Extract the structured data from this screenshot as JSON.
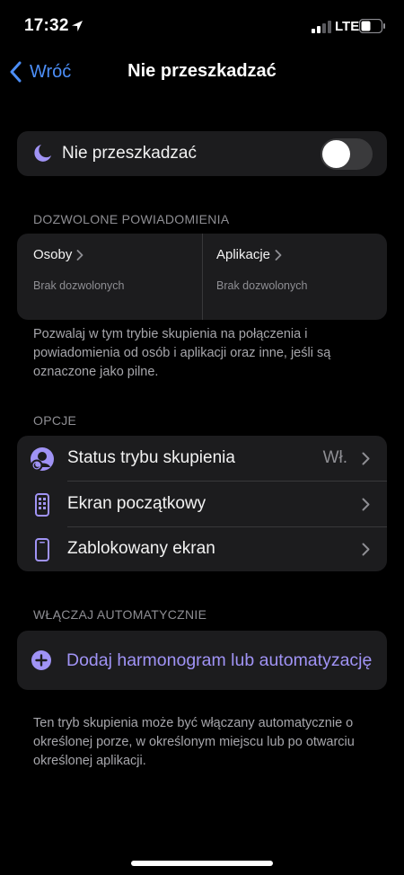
{
  "status_bar": {
    "time": "17:32",
    "network": "LTE"
  },
  "nav": {
    "back_label": "Wróć",
    "title": "Nie przeszkadzać"
  },
  "dnd": {
    "label": "Nie przeszkadzać",
    "toggle_on": false,
    "icon": "moon-icon"
  },
  "allowed": {
    "header": "DOZWOLONE POWIADOMIENIA",
    "people": {
      "title": "Osoby",
      "subtitle": "Brak dozwolonych"
    },
    "apps": {
      "title": "Aplikacje",
      "subtitle": "Brak dozwolonych"
    },
    "footnote": "Pozwalaj w tym trybie skupienia na połączenia i powiadomienia od osób i aplikacji oraz inne, jeśli są oznaczone jako pilne."
  },
  "options": {
    "header": "OPCJE",
    "items": [
      {
        "label": "Status trybu skupienia",
        "value": "Wł.",
        "icon": "focus-status-icon"
      },
      {
        "label": "Ekran początkowy",
        "value": "",
        "icon": "home-screen-icon"
      },
      {
        "label": "Zablokowany ekran",
        "value": "",
        "icon": "lock-screen-icon"
      }
    ]
  },
  "automation": {
    "header": "WŁĄCZAJ AUTOMATYCZNIE",
    "add_label": "Dodaj harmonogram lub automatyzację",
    "footnote": "Ten tryb skupienia może być włączany automatycznie o określonej porze, w określonym miejscu lub po otwarciu określonej aplikacji."
  },
  "colors": {
    "accent_purple": "#a093f5",
    "link_blue": "#4c8ef7",
    "card_bg": "#1c1c1e",
    "secondary_text": "#8e8e93"
  }
}
